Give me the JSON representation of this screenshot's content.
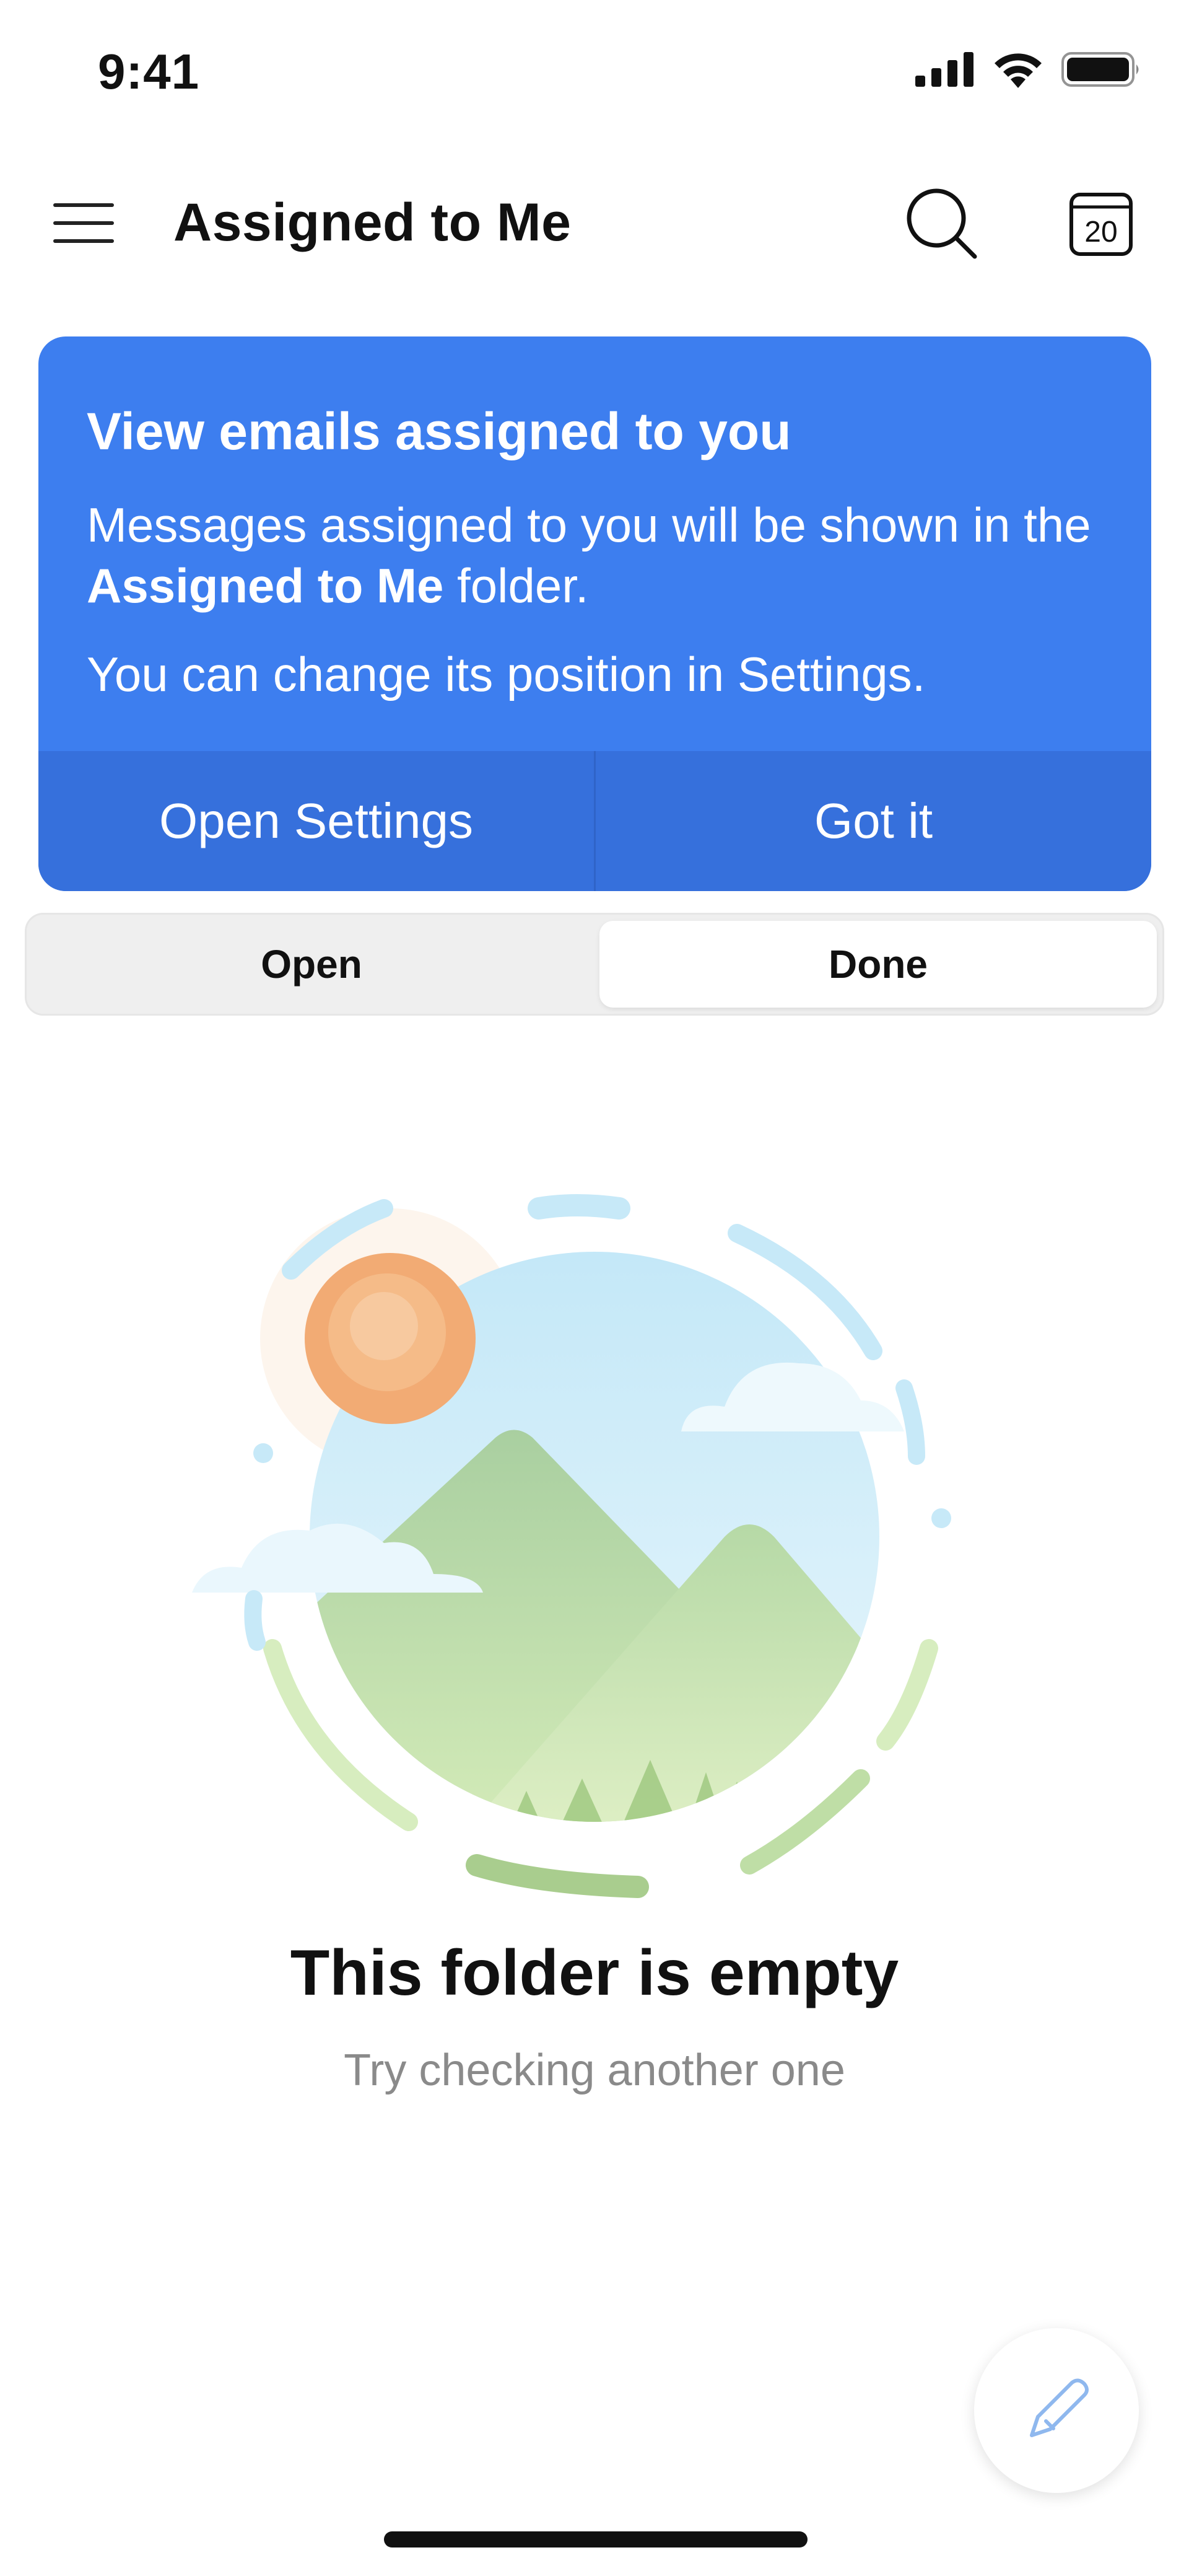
{
  "status_bar": {
    "time": "9:41",
    "icons": [
      "signal-icon",
      "wifi-icon",
      "battery-icon"
    ]
  },
  "header": {
    "title": "Assigned to Me",
    "menu_icon": "hamburger-menu-icon",
    "search_icon": "search-icon",
    "calendar_day": "20"
  },
  "banner": {
    "title": "View emails assigned to you",
    "body_prefix": "Messages assigned to you will be shown in the ",
    "body_bold": "Assigned to Me",
    "body_suffix": " folder.",
    "note": "You can change its position in Settings.",
    "primary_button": "Open Settings",
    "secondary_button": "Got it",
    "accent_color": "#3d7eef"
  },
  "segments": {
    "items": [
      "Open",
      "Done"
    ],
    "selected": "Done"
  },
  "empty_state": {
    "title": "This folder is empty",
    "subtitle": "Try checking another one",
    "illustration": "landscape-illustration"
  },
  "fab": {
    "icon": "compose-pen-icon"
  }
}
